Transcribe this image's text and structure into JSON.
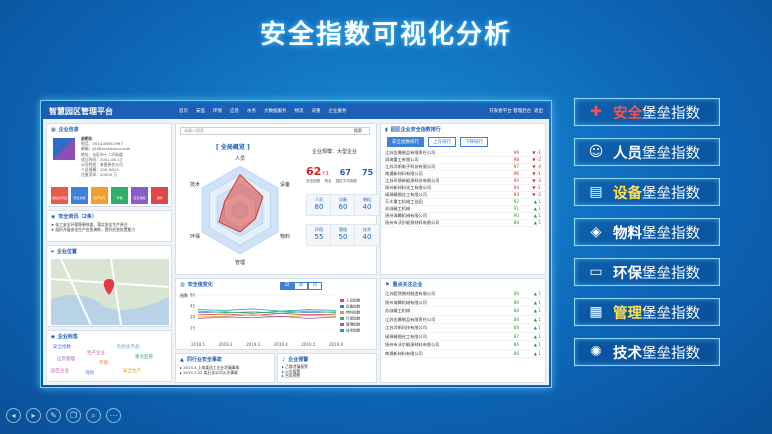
{
  "title": "安全指数可视化分析",
  "platform": {
    "name": "智慧园区管理平台",
    "nav": [
      "首页",
      "安监",
      "环保",
      "应急",
      "水务",
      "大数据服务",
      "物流",
      "双重",
      "企业服务"
    ],
    "user": "开发者平台 管理后台",
    "logout": "退出"
  },
  "company_info": {
    "header": "企业信息",
    "name": "启明化",
    "lines": [
      "电话：0514-65612997",
      "邮箱：jjkl@ssnshssou.com",
      "地址：仪征市十二圩街道",
      "成立时间：2001-06-13",
      "公司性质：有限责任公司",
      "人员规模：100-500人",
      "注册资本：20000 万"
    ],
    "tags": [
      "危险化学品",
      "安全评级",
      "生产许可",
      "环保",
      "应急预案",
      "消防"
    ]
  },
  "safety_news": {
    "header": "安全资讯（2条）",
    "items": [
      "➤ 化工安全环保隐患排查，落实安全生产责任",
      "➤ 组织开展安全生产应急演练，提升应急处置能力"
    ]
  },
  "location": {
    "header": "企业位置"
  },
  "tags_panel": {
    "header": "企业标签",
    "words": [
      "安全指数",
      "生产企业",
      "危险化学品",
      "应急管理",
      "环保",
      "重点监管",
      "园区企业",
      "消防",
      "安全生产"
    ]
  },
  "center": {
    "search_placeholder": "请输入搜索",
    "search_btn": "搜索",
    "radar_title": "全局概览",
    "radar_labels": [
      "人员",
      "设备",
      "物料",
      "环保",
      "管理",
      "技术"
    ],
    "company_scale": "企业规模：大型企业",
    "index_big": "62",
    "index_sub": "↑3",
    "rank": "67",
    "park_avg": "75",
    "label_index": "安全指数",
    "label_rank": "排名",
    "label_avg": "园区平均指数",
    "grid": [
      {
        "label": "人员",
        "value": "80"
      },
      {
        "label": "设备",
        "value": "60"
      },
      {
        "label": "物料",
        "value": "40"
      },
      {
        "label": "环保",
        "value": "55"
      },
      {
        "label": "管理",
        "value": "50"
      },
      {
        "label": "技术",
        "value": "40"
      }
    ]
  },
  "trend": {
    "header": "安全值变化",
    "tabs": [
      "日",
      "周",
      "月"
    ],
    "ylabel": "指数",
    "legend": [
      "人员指数",
      "设备指数",
      "物料指数",
      "环保指数",
      "管理指数",
      "技术指数"
    ]
  },
  "accidents": {
    "header": "同行业安全事故",
    "items": [
      "▸ 2013.4 上海某化工企业泄漏事故",
      "▸ 2015.7.23 某石化公司火灾事故"
    ]
  },
  "warnings": {
    "header": "企业预警",
    "items": [
      "▸ 乙醇泄漏报警",
      "▸ 火灾报警",
      "▸ 台风预警"
    ]
  },
  "rank_panel": {
    "header": "园区企业安全指数排行",
    "tabs": [
      "安全指数排行",
      "上升排行",
      "下降排行"
    ],
    "rows": [
      {
        "name": "江苏金属制品有限责任公司",
        "score": "99",
        "trend": "▼ -1",
        "up": false
      },
      {
        "name": "润海重工有限公司",
        "score": "98",
        "trend": "▼ -2",
        "up": false
      },
      {
        "name": "江苏洋帆电子科技有限公司",
        "score": "97",
        "trend": "▼ -4",
        "up": false
      },
      {
        "name": "南通新材料有限公司",
        "score": "96",
        "trend": "▼ -1",
        "up": false
      },
      {
        "name": "江苏环境新能源科技有限公司",
        "score": "95",
        "trend": "▼ -3",
        "up": false
      },
      {
        "name": "扬州新材料化工有限公司",
        "score": "94",
        "trend": "▼ -1",
        "up": false
      },
      {
        "name": "绿源精细化工有限公司",
        "score": "93",
        "trend": "▼ -2",
        "up": false
      },
      {
        "name": "万丰重工机械工业园",
        "score": "92",
        "trend": "▲ 1",
        "up": true
      },
      {
        "name": "苏溢精工机械",
        "score": "91",
        "trend": "▲ 1",
        "up": true
      },
      {
        "name": "扬州海腾机械有限公司",
        "score": "90",
        "trend": "▲ 1",
        "up": true
      },
      {
        "name": "扬州市沃尔能源材料有限公司",
        "score": "89",
        "trend": "▲ 1",
        "up": true
      }
    ]
  },
  "focus_panel": {
    "header": "重点关注企业",
    "rows": [
      {
        "name": "江苏超然钢材制造有限公司",
        "score": "89",
        "trend": "▲ 1"
      },
      {
        "name": "扬州海腾机械有限公司",
        "score": "89",
        "trend": "▲ 1"
      },
      {
        "name": "苏溢精工机械",
        "score": "88",
        "trend": "▲ 1"
      },
      {
        "name": "江苏金属制品有限责任公司",
        "score": "88",
        "trend": "▲ 1"
      },
      {
        "name": "江苏洋帆科技有限公司",
        "score": "88",
        "trend": "▲ 1"
      },
      {
        "name": "绿源精细化工有限公司",
        "score": "87",
        "trend": "▲ 1"
      },
      {
        "name": "扬州市沃尔能源材料有限公司",
        "score": "86",
        "trend": "▲ 1"
      },
      {
        "name": "南通新材料有限公司",
        "score": "86",
        "trend": "▲ 1"
      }
    ]
  },
  "side_menu": [
    {
      "accent": "安全",
      "rest": "堡垒指数",
      "color": "#ff4d4d",
      "icon": "✚"
    },
    {
      "accent": "人员",
      "rest": "堡垒指数",
      "color": "#ffffff",
      "icon": "☺"
    },
    {
      "accent": "设备",
      "rest": "堡垒指数",
      "color": "#ffe14d",
      "icon": "▤"
    },
    {
      "accent": "物料",
      "rest": "堡垒指数",
      "color": "#ffffff",
      "icon": "◈"
    },
    {
      "accent": "环保",
      "rest": "堡垒指数",
      "color": "#ffffff",
      "icon": "▭"
    },
    {
      "accent": "管理",
      "rest": "堡垒指数",
      "color": "#ffe14d",
      "icon": "▦"
    },
    {
      "accent": "技术",
      "rest": "堡垒指数",
      "color": "#ffffff",
      "icon": "✺"
    }
  ],
  "chart_data": {
    "type": "line",
    "title": "安全值变化",
    "ylabel": "指数",
    "x": [
      "2019.1",
      "2019.2",
      "2019.3",
      "2019.4",
      "2019.5",
      "2019.6"
    ],
    "ylim": [
      0,
      60
    ],
    "yticks": [
      15,
      30,
      45,
      60
    ],
    "series": [
      {
        "name": "人员指数",
        "color": "#e0464a",
        "values": [
          33,
          34,
          32,
          35,
          33,
          34
        ]
      },
      {
        "name": "设备指数",
        "color": "#3a7bd5",
        "values": [
          36,
          37,
          35,
          38,
          36,
          37
        ]
      },
      {
        "name": "物料指数",
        "color": "#f29b26",
        "values": [
          30,
          31,
          33,
          30,
          32,
          31
        ]
      },
      {
        "name": "环保指数",
        "color": "#2fb85a",
        "values": [
          38,
          36,
          37,
          35,
          38,
          36
        ]
      },
      {
        "name": "管理指数",
        "color": "#9b59b6",
        "values": [
          28,
          30,
          29,
          31,
          28,
          30
        ]
      },
      {
        "name": "技术指数",
        "color": "#17a2b8",
        "values": [
          40,
          39,
          41,
          38,
          40,
          39
        ]
      }
    ]
  }
}
